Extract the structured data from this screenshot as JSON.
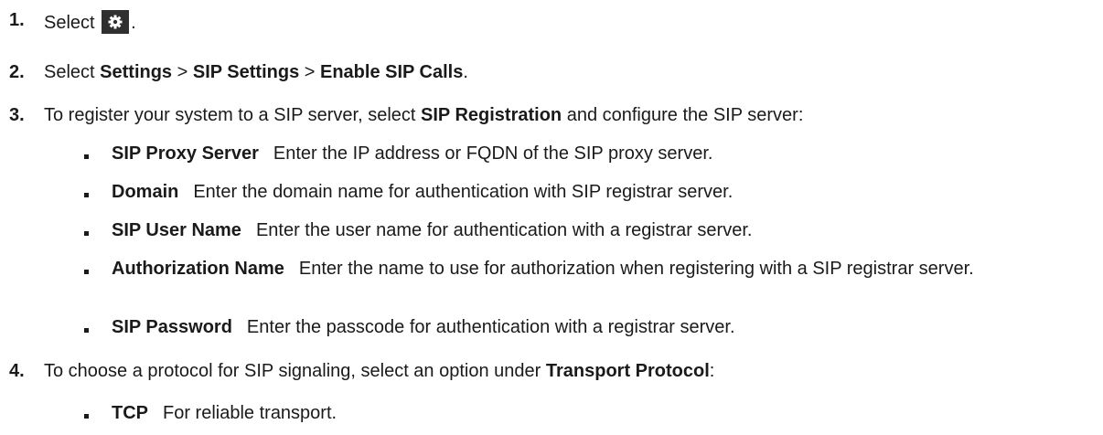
{
  "steps": [
    {
      "number": "1.",
      "text": "Select",
      "icon": "gear-icon",
      "after": "."
    },
    {
      "number": "2.",
      "pre": "Select ",
      "p1": "Settings",
      "s1": " > ",
      "p2": "SIP Settings",
      "s2": " > ",
      "p3": "Enable SIP Calls",
      "after": "."
    },
    {
      "number": "3.",
      "pre": "To register your system to a SIP server, select ",
      "bold": "SIP Registration",
      "post": " and configure the SIP server:"
    },
    {
      "number": "4.",
      "pre": "To choose a protocol for SIP signaling, select an option under ",
      "bold": "Transport Protocol",
      "post": ":"
    }
  ],
  "registration_fields": [
    {
      "term": "SIP Proxy Server",
      "desc": "Enter the IP address or FQDN of the SIP proxy server."
    },
    {
      "term": "Domain",
      "desc": "Enter the domain name for authentication with SIP registrar server."
    },
    {
      "term": "SIP User Name",
      "desc": "Enter the user name for authentication with a registrar server."
    },
    {
      "term": "Authorization Name",
      "desc": "Enter the name to use for authorization when registering with a SIP registrar server."
    },
    {
      "term": "SIP Password",
      "desc": "Enter the passcode for authentication with a registrar server."
    }
  ],
  "protocol_options": [
    {
      "term": "TCP",
      "desc": "For reliable transport."
    }
  ]
}
